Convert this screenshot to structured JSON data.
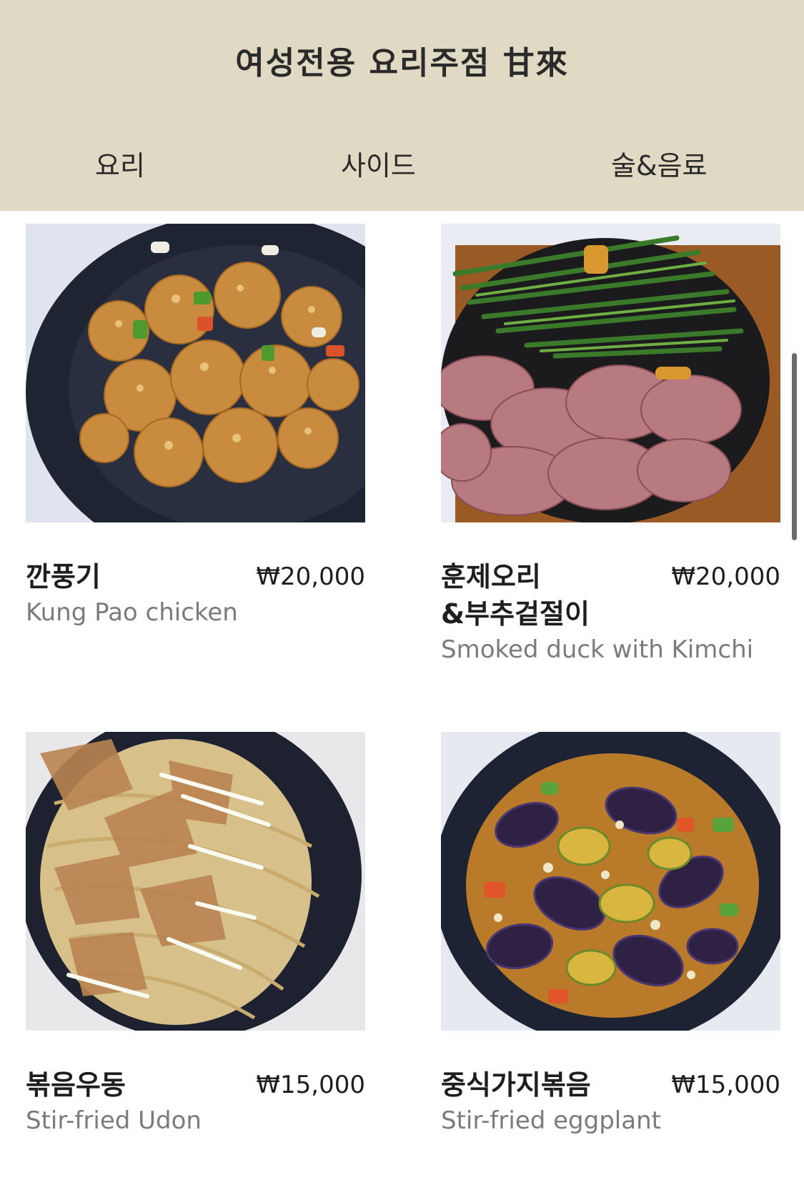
{
  "header": {
    "title": "여성전용 요리주점 甘來",
    "tabs": [
      "요리",
      "사이드",
      "술&음료"
    ]
  },
  "menu": [
    {
      "name_line1": "깐풍기",
      "name_line2": "",
      "english": "Kung Pao chicken",
      "price": "₩20,000"
    },
    {
      "name_line1": "훈제오리",
      "name_line2": "&부추겉절이",
      "english": "Smoked duck with Kimchi",
      "price": "₩20,000"
    },
    {
      "name_line1": "볶음우동",
      "name_line2": "",
      "english": "Stir-fried Udon",
      "price": "₩15,000"
    },
    {
      "name_line1": "중식가지볶음",
      "name_line2": "",
      "english": "Stir-fried eggplant",
      "price": "₩15,000"
    }
  ],
  "colors": {
    "header_bg": "#e0d9c3",
    "text_primary": "#1e1e1e",
    "text_secondary": "#7b7b7b"
  }
}
